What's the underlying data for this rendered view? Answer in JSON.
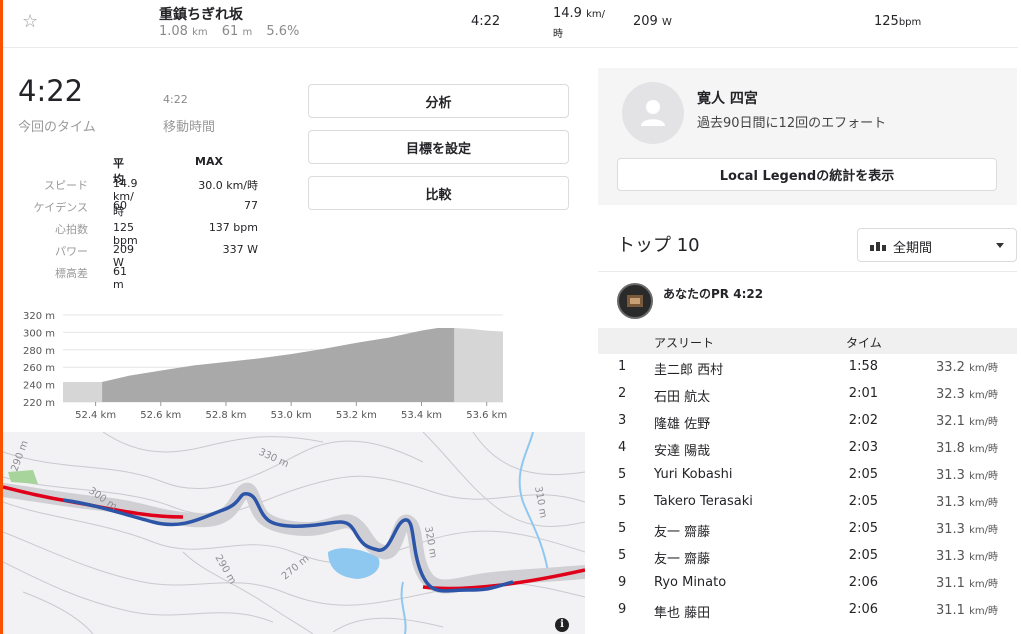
{
  "header": {
    "segment_name": "重鎮ちぎれ坂",
    "distance": "1.08",
    "distance_unit": "km",
    "elev": "61",
    "elev_unit": "m",
    "grade": "5.6%",
    "time": "4:22",
    "speed": "14.9",
    "speed_unit_a": "km/",
    "speed_unit_b": "時",
    "power": "209",
    "power_unit": "W",
    "hr": "125",
    "hr_unit": "bpm"
  },
  "stats": {
    "elapsed_time": "4:22",
    "elapsed_label": "今回のタイム",
    "moving_time": "4:22",
    "moving_label": "移動時間",
    "col_avg": "平均",
    "col_max": "MAX",
    "rows": [
      {
        "label": "スピード",
        "avg": "14.9 km/時",
        "max": "30.0 km/時"
      },
      {
        "label": "ケイデンス",
        "avg": "60",
        "max": "77"
      },
      {
        "label": "心拍数",
        "avg": "125 bpm",
        "max": "137 bpm"
      },
      {
        "label": "パワー",
        "avg": "209 W",
        "max": "337 W"
      },
      {
        "label": "標高差",
        "avg": "61 m",
        "max": ""
      }
    ]
  },
  "buttons": {
    "analyze": "分析",
    "set_goal": "目標を設定",
    "compare": "比較"
  },
  "chart_data": {
    "type": "area",
    "title": "",
    "xlabel": "",
    "ylabel": "",
    "x_unit": "km",
    "y_unit": "m",
    "xlim": [
      52.3,
      53.65
    ],
    "ylim": [
      220,
      320
    ],
    "x_ticks": [
      "52.4 km",
      "52.6 km",
      "52.8 km",
      "53.0 km",
      "53.2 km",
      "53.4 km",
      "53.6 km"
    ],
    "y_ticks": [
      "320 m",
      "300 m",
      "280 m",
      "260 m",
      "240 m",
      "220 m"
    ],
    "highlight_range": [
      52.42,
      53.5
    ],
    "x": [
      52.3,
      52.42,
      52.5,
      52.6,
      52.7,
      52.8,
      52.9,
      53.0,
      53.1,
      53.2,
      53.3,
      53.4,
      53.45,
      53.5,
      53.55,
      53.6,
      53.65
    ],
    "y": [
      243,
      243,
      250,
      256,
      262,
      266,
      270,
      275,
      281,
      288,
      294,
      302,
      305,
      305,
      304,
      302,
      301
    ]
  },
  "map": {
    "contour_labels": [
      "290 m",
      "300 m",
      "330 m",
      "290 m",
      "270 m",
      "310 m",
      "320 m"
    ],
    "info": "i"
  },
  "local_legend": {
    "name": "寛人 四宮",
    "subtitle": "過去90日間に12回のエフォート",
    "button": "Local Legendの統計を表示"
  },
  "leaderboard": {
    "title": "トップ 10",
    "filter": "全期間",
    "your_pr": "あなたのPR 4:22",
    "col_athlete": "アスリート",
    "col_time": "タイム",
    "speed_unit": "km/時",
    "rows": [
      {
        "rank": "1",
        "name": "圭二郎 西村",
        "time": "1:58",
        "speed": "33.2"
      },
      {
        "rank": "2",
        "name": "石田 航太",
        "time": "2:01",
        "speed": "32.3"
      },
      {
        "rank": "3",
        "name": "隆雄 佐野",
        "time": "2:02",
        "speed": "32.1"
      },
      {
        "rank": "4",
        "name": "安達 陽哉",
        "time": "2:03",
        "speed": "31.8"
      },
      {
        "rank": "5",
        "name": "Yuri Kobashi",
        "time": "2:05",
        "speed": "31.3"
      },
      {
        "rank": "5",
        "name": "Takero Terasaki",
        "time": "2:05",
        "speed": "31.3"
      },
      {
        "rank": "5",
        "name": "友一 齋藤",
        "time": "2:05",
        "speed": "31.3"
      },
      {
        "rank": "5",
        "name": "友一 齋藤",
        "time": "2:05",
        "speed": "31.3"
      },
      {
        "rank": "9",
        "name": "Ryo Minato",
        "time": "2:06",
        "speed": "31.1"
      },
      {
        "rank": "9",
        "name": "隼也 藤田",
        "time": "2:06",
        "speed": "31.1"
      }
    ]
  }
}
